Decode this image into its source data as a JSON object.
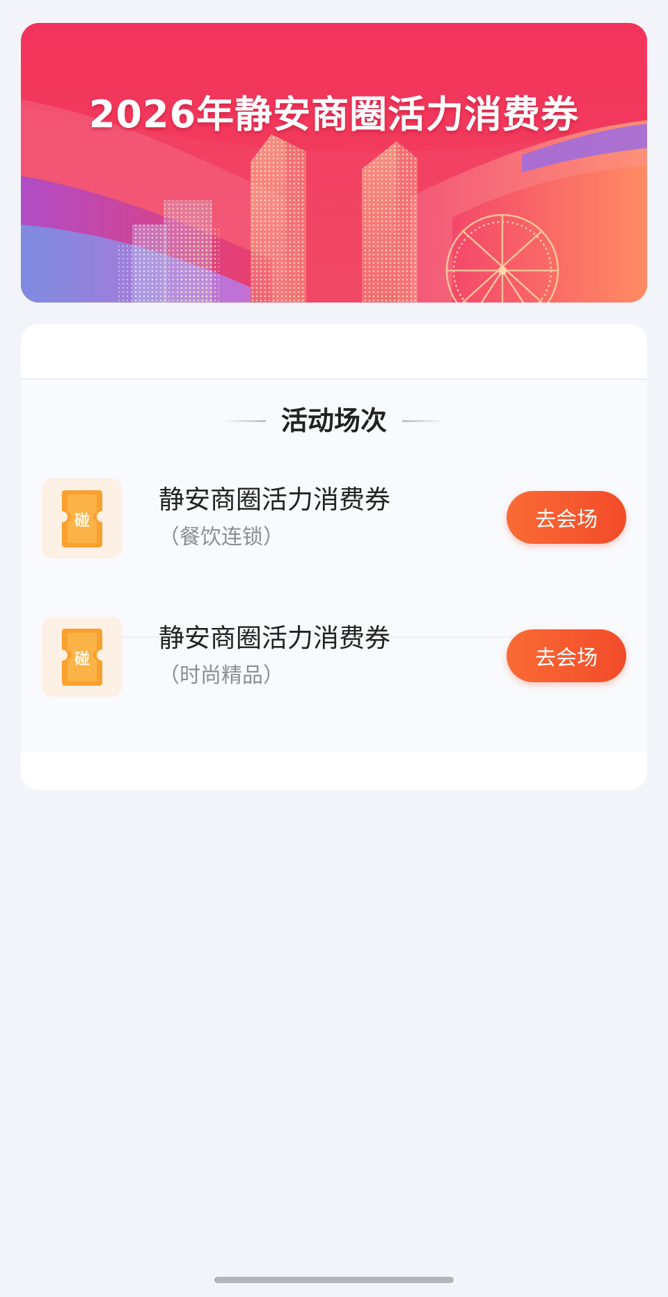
{
  "banner": {
    "title": "2026年静安商圈活力消费券"
  },
  "section": {
    "heading": "活动场次"
  },
  "sessions": [
    {
      "title": "静安商圈活力消费券",
      "subtitle": "（餐饮连锁）",
      "button_label": "去会场",
      "icon": "ticket-icon"
    },
    {
      "title": "静安商圈活力消费券",
      "subtitle": "（时尚精品）",
      "button_label": "去会场",
      "icon": "ticket-icon"
    }
  ],
  "ticket_icon_glyph": "碰",
  "colors": {
    "page_background": "#f3f3fa",
    "banner_primary": "#f3335c",
    "button_start": "#fa6b35",
    "button_end": "#f24b29",
    "ticket": "#f9a02f"
  }
}
